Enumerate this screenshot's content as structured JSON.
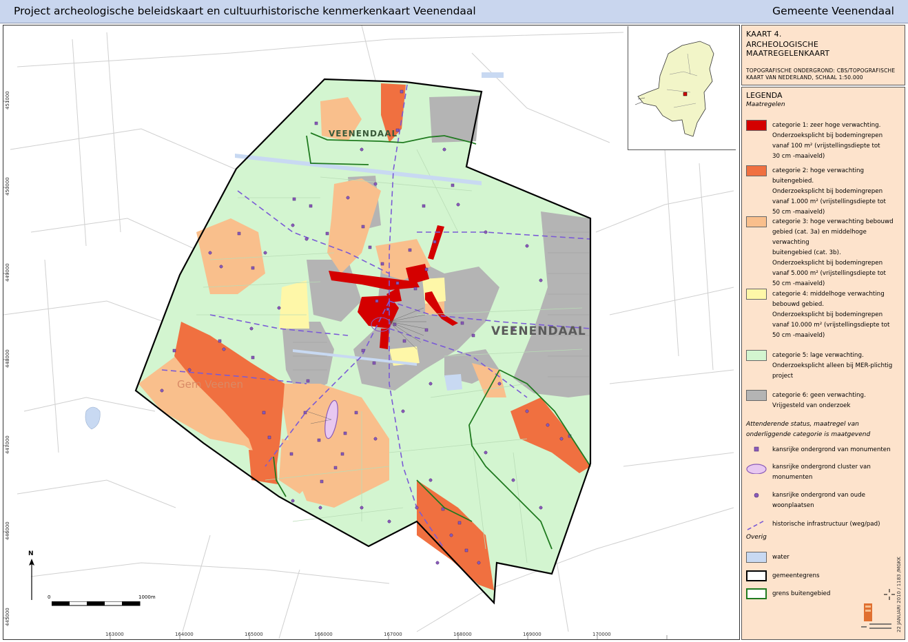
{
  "header": {
    "title": "Project archeologische beleidskaart en cultuurhistorische kenmerkenkaart Veenendaal",
    "organisation": "Gemeente Veenendaal"
  },
  "map": {
    "x_ticks": [
      "163000",
      "164000",
      "165000",
      "166000",
      "167000",
      "168000",
      "169000",
      "170000"
    ],
    "y_ticks": [
      "451000",
      "450000",
      "449000",
      "448000",
      "447000",
      "446000",
      "445000"
    ],
    "place_labels": {
      "main": "VEENENDAAL",
      "north": "VEENENDAAL",
      "gem_west": "Gem Veenen"
    },
    "scale": {
      "start": "0",
      "end": "1000m"
    },
    "north_arrow": "N",
    "colors": {
      "cat1": "#d40000",
      "cat2": "#f07040",
      "cat3": "#f9bf8c",
      "cat4": "#fef7a8",
      "cat5": "#d3f5d0",
      "cat6": "#b4b4b4",
      "water": "#c8d9f2",
      "border": "#000000",
      "outer_border": "#1f7a1f",
      "monument": "#8a5bb8"
    }
  },
  "side_title": {
    "line1": "KAART 4.",
    "line2": "ARCHEOLOGISCHE MAATREGELENKAART",
    "line3": "TOPOGRAFISCHE ONDERGROND: CBS/TOPOGRAFISCHE",
    "line4": "KAART VAN NEDERLAND, SCHAAL 1:50.000"
  },
  "legend": {
    "title": "LEGENDA",
    "subtitle": "Maatregelen",
    "categories": [
      {
        "lines": [
          "categorie 1: zeer hoge verwachting.",
          "Onderzoeksplicht bij bodemingrepen",
          "vanaf 100 m² (vrijstellingsdiepte tot",
          "30 cm -maaiveld)"
        ]
      },
      {
        "lines": [
          "categorie 2: hoge verwachting buitengebied.",
          "Onderzoeksplicht bij bodemingrepen",
          "vanaf 1.000 m² (vrijstellingsdiepte tot",
          "50 cm -maaiveld)"
        ]
      },
      {
        "lines": [
          "categorie 3: hoge verwachting bebouwd",
          "gebied (cat. 3a) en middelhoge verwachting",
          "buitengebied (cat. 3b).",
          "Onderzoeksplicht bij bodemingrepen",
          "vanaf 5.000 m² (vrijstellingsdiepte tot",
          "50 cm -maaiveld)"
        ]
      },
      {
        "lines": [
          "categorie 4: middelhoge verwachting",
          "bebouwd gebied.",
          "Onderzoeksplicht bij bodemingrepen",
          "vanaf 10.000 m² (vrijstellingsdiepte tot",
          "50 cm -maaiveld)"
        ]
      },
      {
        "lines": [
          "categorie 5: lage verwachting.",
          "Onderzoeksplicht alleen bij MER-plichtig",
          "project"
        ]
      },
      {
        "lines": [
          "categorie 6: geen verwachting.",
          "Vrijgesteld van onderzoek"
        ]
      }
    ],
    "attend_heading": "Attenderende status, maatregel van onderliggende categorie is maatgevend",
    "symbols": [
      {
        "lines": [
          "kansrijke ondergrond van monumenten"
        ]
      },
      {
        "lines": [
          "kansrijke ondergrond cluster van",
          "monumenten"
        ]
      },
      {
        "lines": [
          "kansrijke ondergrond van oude",
          "woonplaatsen"
        ]
      },
      {
        "lines": [
          "historische infrastructuur (weg/pad)"
        ]
      }
    ],
    "other_heading": "Overig",
    "other": [
      {
        "label": "water"
      },
      {
        "label": "gemeentegrens"
      },
      {
        "label": "grens buitengebied"
      }
    ],
    "footer": "22 JANUARI 2010 / 1183 /MGKK"
  }
}
